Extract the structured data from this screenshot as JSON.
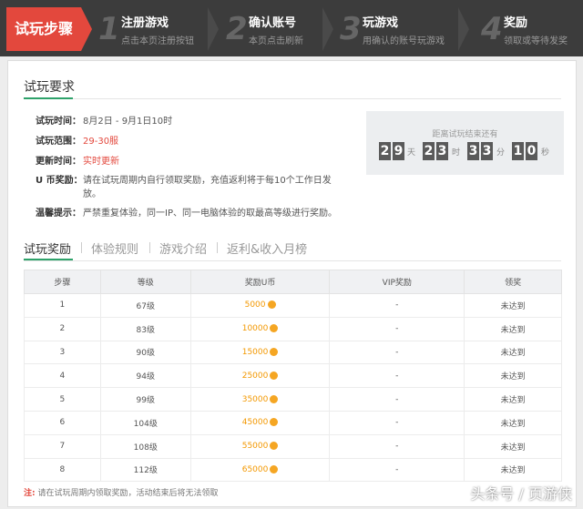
{
  "steps": {
    "current": "试玩步骤",
    "items": [
      {
        "num": "1",
        "title": "注册游戏",
        "sub": "点击本页注册按钮"
      },
      {
        "num": "2",
        "title": "确认账号",
        "sub": "本页点击刷新"
      },
      {
        "num": "3",
        "title": "玩游戏",
        "sub": "用确认的账号玩游戏"
      },
      {
        "num": "4",
        "title": "奖励",
        "sub": "领取或等待发奖"
      }
    ]
  },
  "requirements": {
    "title": "试玩要求",
    "rows": [
      {
        "label": "试玩时间：",
        "value": "8月2日 - 9月1日10时"
      },
      {
        "label": "试玩范围：",
        "value": "29-30服"
      },
      {
        "label": "更新时间：",
        "value": "实时更新"
      },
      {
        "label": "U 币奖励：",
        "value": "请在试玩周期内自行领取奖励，充值返利将于每10个工作日发",
        "value2": "放。"
      },
      {
        "label": "温馨提示：",
        "value": "严禁重复体验，同一IP、同一电脑体验的取最高等级进行奖励。"
      }
    ]
  },
  "timer": {
    "label": "距离试玩结束还有",
    "days": [
      "2",
      "9"
    ],
    "days_unit": "天",
    "hours": [
      "2",
      "3"
    ],
    "hours_unit": "时",
    "minutes": [
      "3",
      "3"
    ],
    "minutes_unit": "分",
    "seconds": [
      "1",
      "0"
    ],
    "seconds_unit": "秒"
  },
  "tabs": [
    "试玩奖励",
    "体验规则",
    "游戏介绍",
    "返利&收入月榜"
  ],
  "table": {
    "headers": [
      "步骤",
      "等级",
      "奖励U币",
      "VIP奖励",
      "领奖"
    ],
    "rows": [
      [
        "1",
        "67级",
        "5000",
        "-",
        "未达到"
      ],
      [
        "2",
        "83级",
        "10000",
        "-",
        "未达到"
      ],
      [
        "3",
        "90级",
        "15000",
        "-",
        "未达到"
      ],
      [
        "4",
        "94级",
        "25000",
        "-",
        "未达到"
      ],
      [
        "5",
        "99级",
        "35000",
        "-",
        "未达到"
      ],
      [
        "6",
        "104级",
        "45000",
        "-",
        "未达到"
      ],
      [
        "7",
        "108级",
        "55000",
        "-",
        "未达到"
      ],
      [
        "8",
        "112级",
        "65000",
        "-",
        "未达到"
      ]
    ]
  },
  "note": {
    "prefix": "注:",
    "text": "请在试玩周期内领取奖励，活动结束后将无法领取"
  },
  "watermark": "头条号 / 页游侠"
}
